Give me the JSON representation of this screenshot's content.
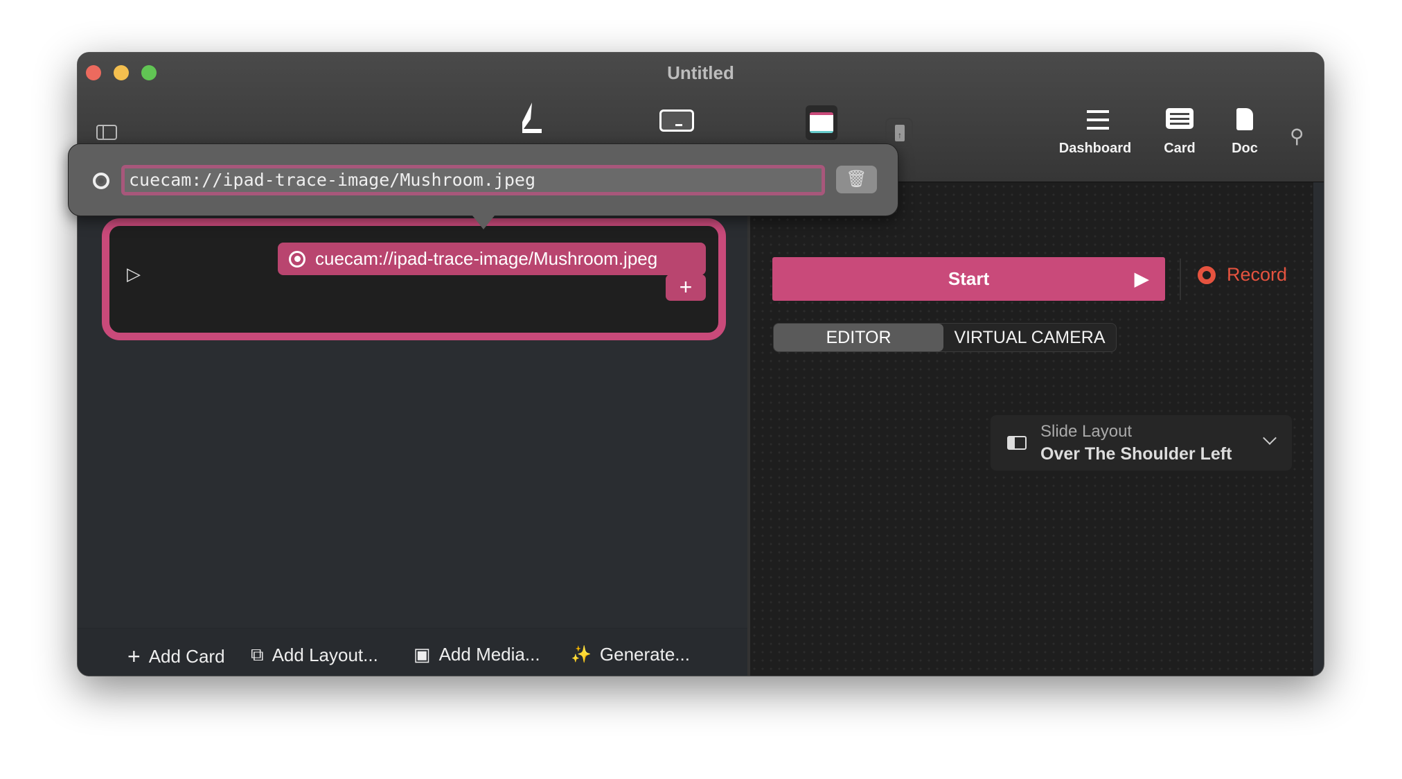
{
  "window": {
    "title": "Untitled"
  },
  "toolbar": {
    "icons": [
      "sidebar-toggle-icon",
      "pen-icon",
      "terminal-icon",
      "notepad-icon",
      "document-upload-icon",
      "search-icon"
    ],
    "dashboard_label": "Dashboard",
    "card_label": "Card",
    "doc_label": "Doc"
  },
  "popover": {
    "url_value": "cuecam://ipad-trace-image/Mushroom.jpeg"
  },
  "card": {
    "media_label": "cuecam://ipad-trace-image/Mushroom.jpeg",
    "add_label": "+"
  },
  "bottom_bar": {
    "add_card": "Add Card",
    "add_layout": "Add Layout...",
    "add_media": "Add Media...",
    "generate": "Generate..."
  },
  "right_panel": {
    "start_label": "Start",
    "record_label": "Record",
    "segments": [
      "EDITOR",
      "VIRTUAL CAMERA"
    ],
    "selected_segment": "EDITOR",
    "slide_layout_label": "Slide Layout",
    "slide_layout_value": "Over The Shoulder Left"
  },
  "colors": {
    "accent": "#c94a7a",
    "record": "#e5533f"
  }
}
